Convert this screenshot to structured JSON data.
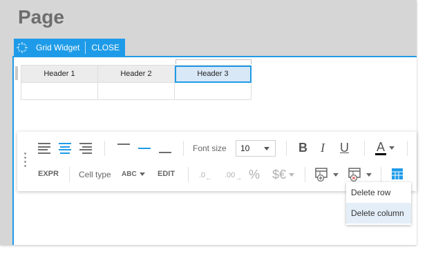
{
  "page": {
    "title": "Page"
  },
  "widget": {
    "name": "Grid Widget",
    "close_label": "CLOSE"
  },
  "grid": {
    "headers": [
      "Header 1",
      "Header 2",
      "Header 3"
    ],
    "selected_header": "Header 3"
  },
  "toolbar": {
    "font_size_label": "Font size",
    "font_size_value": "10",
    "expr_label": "EXPR",
    "cell_type_label": "Cell type",
    "cell_type_value": "ABC",
    "edit_label": "EDIT",
    "bold_label": "B",
    "italic_label": "I",
    "underline_label": "U",
    "font_color_label": "A",
    "dec_decrease_label": ".0",
    "dec_increase_label": ".00",
    "percent_label": "%",
    "currency_label": "$€"
  },
  "context_menu": {
    "items": [
      "Delete row",
      "Delete column"
    ],
    "hovered": "Delete column"
  },
  "colors": {
    "accent": "#1e9be8",
    "page_bg": "#d6d6d6"
  }
}
